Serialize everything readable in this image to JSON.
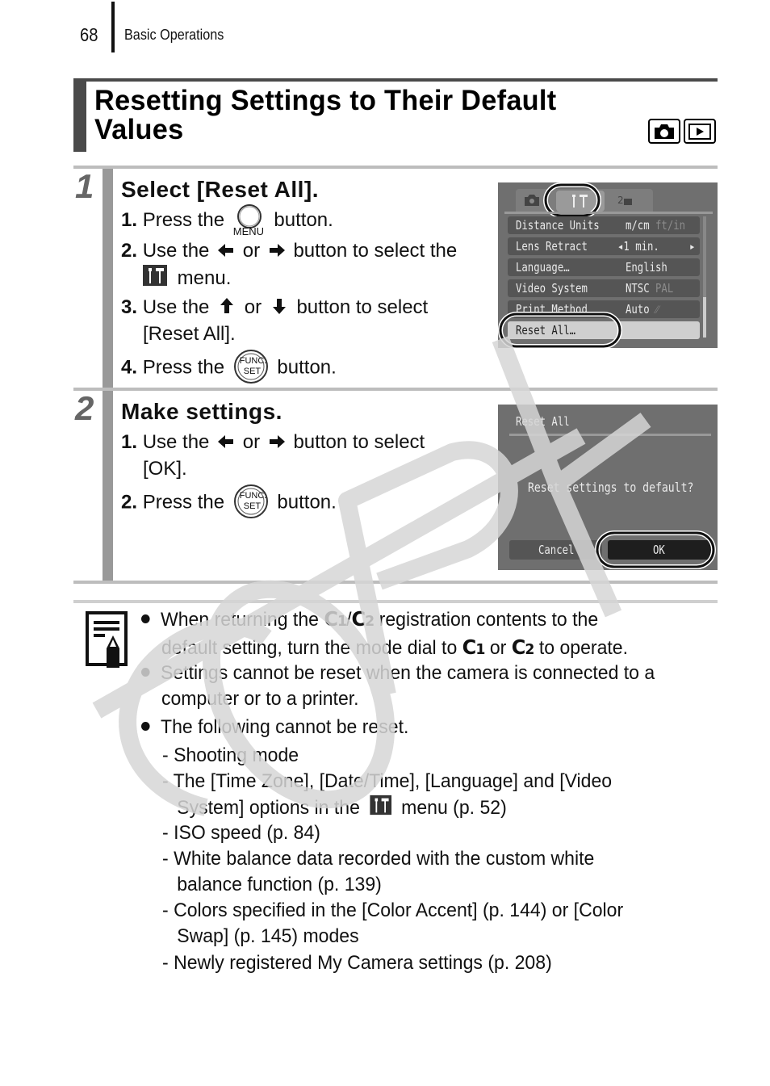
{
  "header": {
    "page_number": "68",
    "section": "Basic Operations"
  },
  "title": {
    "line1": "Resetting Settings to Their Default",
    "line2": "Values",
    "mode_icons": [
      "camera-icon",
      "playback-icon"
    ]
  },
  "steps": [
    {
      "number": "1",
      "title": "Select [Reset All].",
      "instructions": [
        {
          "num": "1.",
          "pre": "Press the",
          "icon": "menu-button-icon",
          "icon_label": "MENU",
          "post": "button."
        },
        {
          "num": "2.",
          "pre": "Use the",
          "icon1": "left-arrow-icon",
          "mid": "or",
          "icon2": "right-arrow-icon",
          "post": "button to select the",
          "cont_icon": "setup-menu-icon",
          "cont": "menu."
        },
        {
          "num": "3.",
          "pre": "Use the",
          "icon1": "up-arrow-icon",
          "mid": "or",
          "icon2": "down-arrow-icon",
          "post": "button to select",
          "cont": "[Reset All]."
        },
        {
          "num": "4.",
          "pre": "Press the",
          "icon": "func-set-button-icon",
          "icon_label_top": "FUNC.",
          "icon_label_bottom": "SET",
          "post": "button."
        }
      ],
      "screen": {
        "tabs": [
          "camera-tab-icon",
          "setup-tab-icon",
          "my-camera-tab-icon"
        ],
        "active_tab": "setup-tab-icon",
        "rows": [
          {
            "label": "Distance Units",
            "value": "m/cm",
            "alt": "ft/in"
          },
          {
            "label": "Lens Retract",
            "value": "1 min.",
            "arrows": true
          },
          {
            "label": "Language…",
            "value": "English"
          },
          {
            "label": "Video System",
            "value": "NTSC",
            "alt": "PAL"
          },
          {
            "label": "Print Method",
            "value": "Auto",
            "alt_icon": "printer-icon"
          },
          {
            "label": "Reset All…",
            "value": "",
            "selected": true
          }
        ]
      }
    },
    {
      "number": "2",
      "title": "Make settings.",
      "instructions": [
        {
          "num": "1.",
          "pre": "Use the",
          "icon1": "left-arrow-icon",
          "mid": "or",
          "icon2": "right-arrow-icon",
          "post": "button to select",
          "cont": "[OK]."
        },
        {
          "num": "2.",
          "pre": "Press the",
          "icon": "func-set-button-icon",
          "icon_label_top": "FUNC.",
          "icon_label_bottom": "SET",
          "post": "button."
        }
      ],
      "screen": {
        "heading": "Reset All",
        "message": "Reset settings to default?",
        "buttons": [
          "Cancel",
          "OK"
        ],
        "selected_button": "OK"
      }
    }
  ],
  "notes": {
    "icon": "note-pencil-icon",
    "bullets": [
      {
        "pre": "When returning the",
        "c1": "C",
        "c1n": "1",
        "slash": "/",
        "c2": "C",
        "c2n": "2",
        "post": "registration contents to the",
        "cont_pre": "default setting, turn the mode dial to",
        "cont_or": "or",
        "cont_post": "to operate."
      },
      {
        "line1": "Settings cannot be reset when the camera is connected to a",
        "line2": "computer or to a printer."
      },
      {
        "line1": "The following cannot be reset."
      }
    ],
    "cannot_reset": [
      {
        "line1": "Shooting mode"
      },
      {
        "line1": "The [Time Zone], [Date/Time], [Language] and [Video",
        "line2_pre": "System] options in the",
        "line2_icon": "setup-menu-icon",
        "line2_post": "menu (p. 52)"
      },
      {
        "line1": "ISO speed (p. 84)"
      },
      {
        "line1": "White balance data recorded with the custom white",
        "line2": "balance function (p. 139)"
      },
      {
        "line1": "Colors specified in the [Color Accent] (p. 144) or [Color",
        "line2": "Swap] (p. 145) modes"
      },
      {
        "line1": "Newly registered My Camera settings (p. 208)"
      }
    ],
    "dash": "-"
  },
  "watermark": {
    "text": "COPY"
  }
}
